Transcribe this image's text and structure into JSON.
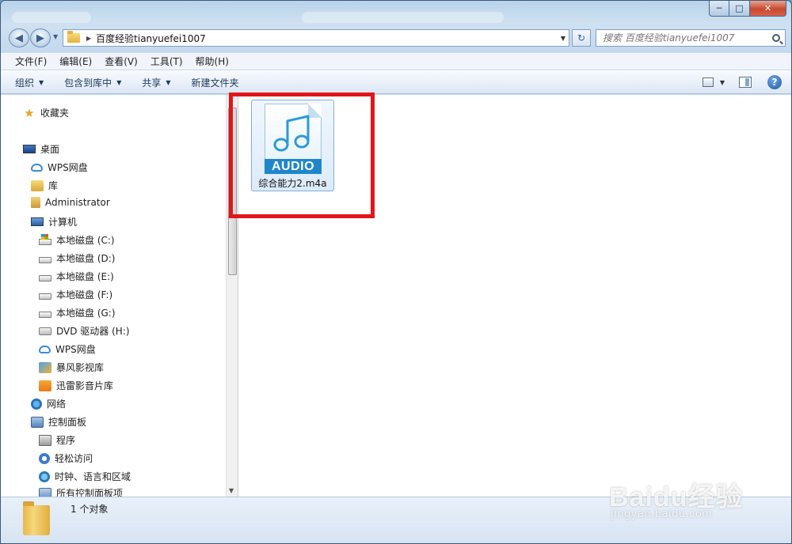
{
  "window": {
    "controls": {
      "minimize": "─",
      "maximize": "□",
      "close": "✕"
    }
  },
  "navigation": {
    "back": "◀",
    "forward": "▶",
    "breadcrumb_arrow": "▶",
    "path": "百度经验tianyuefei1007",
    "dropdown": "▼",
    "refresh": "↻"
  },
  "search": {
    "placeholder": "搜索 百度经验tianyuefei1007"
  },
  "menubar": {
    "items": [
      "文件(F)",
      "编辑(E)",
      "查看(V)",
      "工具(T)",
      "帮助(H)"
    ]
  },
  "toolbar": {
    "organize": "组织",
    "include_in_library": "包含到库中",
    "share": "共享",
    "new_folder": "新建文件夹",
    "dropdown": "▼",
    "help": "?"
  },
  "sidebar": {
    "items": [
      {
        "label": "收藏夹",
        "icon": "star-icon"
      },
      {
        "label": "桌面",
        "icon": "desktop-icon"
      },
      {
        "label": "WPS网盘",
        "icon": "cloud-icon"
      },
      {
        "label": "库",
        "icon": "library-icon"
      },
      {
        "label": "Administrator",
        "icon": "user-folder-icon"
      },
      {
        "label": "计算机",
        "icon": "computer-icon"
      },
      {
        "label": "本地磁盘 (C:)",
        "icon": "system-drive-icon"
      },
      {
        "label": "本地磁盘 (D:)",
        "icon": "drive-icon"
      },
      {
        "label": "本地磁盘 (E:)",
        "icon": "drive-icon"
      },
      {
        "label": "本地磁盘 (F:)",
        "icon": "drive-icon"
      },
      {
        "label": "本地磁盘 (G:)",
        "icon": "drive-icon"
      },
      {
        "label": "DVD 驱动器 (H:)",
        "icon": "dvd-drive-icon"
      },
      {
        "label": "WPS网盘",
        "icon": "cloud-icon"
      },
      {
        "label": "暴风影视库",
        "icon": "baofeng-library-icon"
      },
      {
        "label": "迅雷影音片库",
        "icon": "xunlei-library-icon"
      },
      {
        "label": "网络",
        "icon": "network-icon"
      },
      {
        "label": "控制面板",
        "icon": "control-panel-icon"
      },
      {
        "label": "程序",
        "icon": "programs-icon"
      },
      {
        "label": "轻松访问",
        "icon": "ease-of-access-icon"
      },
      {
        "label": "时钟、语言和区域",
        "icon": "clock-language-icon"
      },
      {
        "label": "所有控制面板项",
        "icon": "all-control-panel-icon"
      }
    ],
    "scroll_down": "▼"
  },
  "files": [
    {
      "name": "综合能力2.m4a",
      "badge": "AUDIO",
      "icon": "audio-file-icon"
    }
  ],
  "statusbar": {
    "text": "1 个对象"
  },
  "watermark": {
    "brand": "Baidu经验",
    "url": "jingyan.baidu.com"
  },
  "colors": {
    "highlight": "#e1161b",
    "audio_badge": "#1f86c9"
  }
}
